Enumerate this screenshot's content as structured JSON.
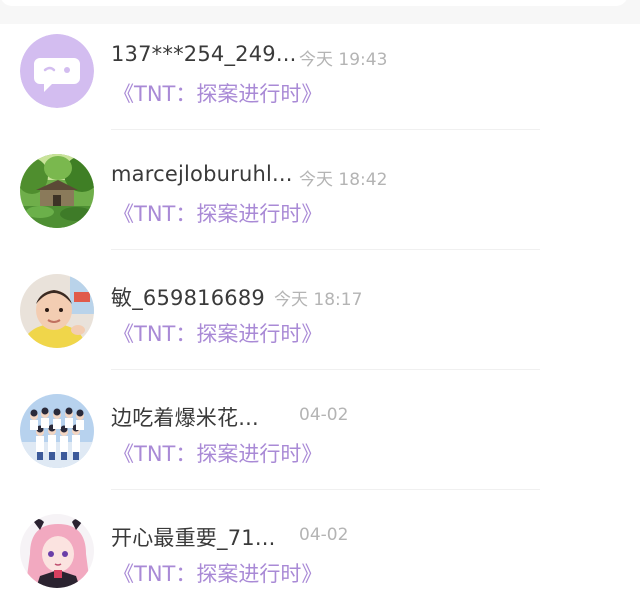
{
  "messages": [
    {
      "name": "137***254_249...",
      "time": "今天 19:43",
      "source": "《TNT：探案进行时》",
      "avatar_icon": "chat-bubble-icon"
    },
    {
      "name": "marcejloburuhl...",
      "time": "今天 18:42",
      "source": "《TNT：探案进行时》",
      "avatar_icon": "forest-house-avatar"
    },
    {
      "name": "敏_659816689",
      "time": "今天 18:17",
      "source": "《TNT：探案进行时》",
      "avatar_icon": "baby-photo-avatar"
    },
    {
      "name": "边吃着爆米花...",
      "time": "04-02",
      "source": "《TNT：探案进行时》",
      "avatar_icon": "group-photo-avatar"
    },
    {
      "name": "开心最重要_71...",
      "time": "04-02",
      "source": "《TNT：探案进行时》",
      "avatar_icon": "anime-girl-avatar"
    }
  ],
  "colors": {
    "accent": "#a98ad6",
    "name_text": "#3a3a3a",
    "time_text": "#b4b4b4",
    "avatar_purple": "#d3bdf0"
  }
}
